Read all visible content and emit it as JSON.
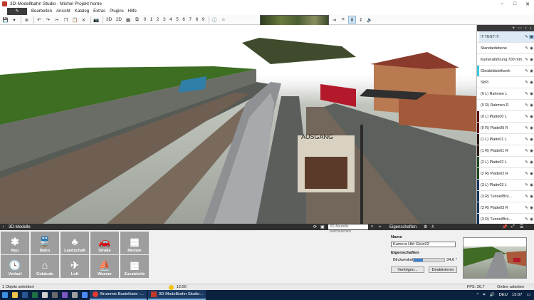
{
  "window": {
    "title": "3D-Modellbahn Studio - Michel Projekt home",
    "min": "–",
    "max": "□",
    "close": "✕"
  },
  "menu": {
    "items": [
      "Bearbeiten",
      "Ansicht",
      "Katalog",
      "Extras",
      "Plugins",
      "Hilfe"
    ]
  },
  "toolbar": {
    "view3d": "3D",
    "view2d": "2D",
    "presets": [
      "0",
      "1",
      "2",
      "3",
      "4",
      "5",
      "6",
      "7",
      "8",
      "9"
    ]
  },
  "viewport": {
    "sign_text": "AUSGANG"
  },
  "layers": {
    "items": [
      {
        "name": "!!! TEST !!!",
        "color": "#ffffff"
      },
      {
        "name": "Standardebene",
        "color": "#ffffff"
      },
      {
        "name": "Kameraführung 700 mm",
        "color": "#ffffff"
      },
      {
        "name": "Gleisbildstellwerk",
        "color": "#3ac6d8"
      },
      {
        "name": "Sbf3",
        "color": "#ffffff"
      },
      {
        "name": "(0 L) Rahmen L",
        "color": "#ffffff"
      },
      {
        "name": "(0 R) Rahmen R",
        "color": "#ffffff"
      },
      {
        "name": "(0 L) Platte00 L",
        "color": "#5a0d0d"
      },
      {
        "name": "(0 R) Platte00 R",
        "color": "#5a0d0d"
      },
      {
        "name": "(1 L) Platte01 L",
        "color": "#2a1a10"
      },
      {
        "name": "(1 R) Platte01 R",
        "color": "#2a1a10"
      },
      {
        "name": "(2 L) Platte02 L",
        "color": "#1f4a1f"
      },
      {
        "name": "(2 R) Platte02 R",
        "color": "#1f4a1f"
      },
      {
        "name": "(3 L) Platte03 L",
        "color": "#17345a"
      },
      {
        "name": "(3 R) Tunnel/Brü...",
        "color": "#17345a"
      },
      {
        "name": "(3 R) Platte03 R",
        "color": "#17345a"
      },
      {
        "name": "(3 R) Tunnel/Brü...",
        "color": "#17345a"
      }
    ]
  },
  "models": {
    "header": "3D-Modelle",
    "search_placeholder": "3D-Modelle durchsuchen",
    "tiles": [
      {
        "label": "Neu",
        "glyph": "✱"
      },
      {
        "label": "Bahn",
        "glyph": "🚆"
      },
      {
        "label": "Landschaft",
        "glyph": "♣"
      },
      {
        "label": "Straße",
        "glyph": "🚗"
      },
      {
        "label": "Module",
        "glyph": "▦"
      },
      {
        "label": "Verlauf",
        "glyph": "🕓"
      },
      {
        "label": "Gebäude",
        "glyph": "⌂"
      },
      {
        "label": "Luft",
        "glyph": "✈"
      },
      {
        "label": "Wasser",
        "glyph": "⛵"
      },
      {
        "label": "Zusatzteile",
        "glyph": "▦"
      }
    ]
  },
  "properties": {
    "header": "Eigenschaften",
    "name_label": "Name",
    "name_value": "Kamera Hbf-Gleis03",
    "section": "Eigenschaften",
    "fov_label": "Blickwinkel:",
    "fov_value": "34,6 °",
    "fov_fraction": 0.3,
    "follow_button": "Verfolgen...",
    "disable_button": "Deaktivieren"
  },
  "status": {
    "selection": "1 Objekt selektiert",
    "time": "12:00",
    "fps": "FPS: 26,7",
    "mode": "Online arbeiten"
  },
  "taskbar": {
    "apps": [
      "Brummis Bastelkiste -...",
      "3D-Modellbahn Studio..."
    ],
    "lang": "DEU",
    "clock": "15:07"
  }
}
